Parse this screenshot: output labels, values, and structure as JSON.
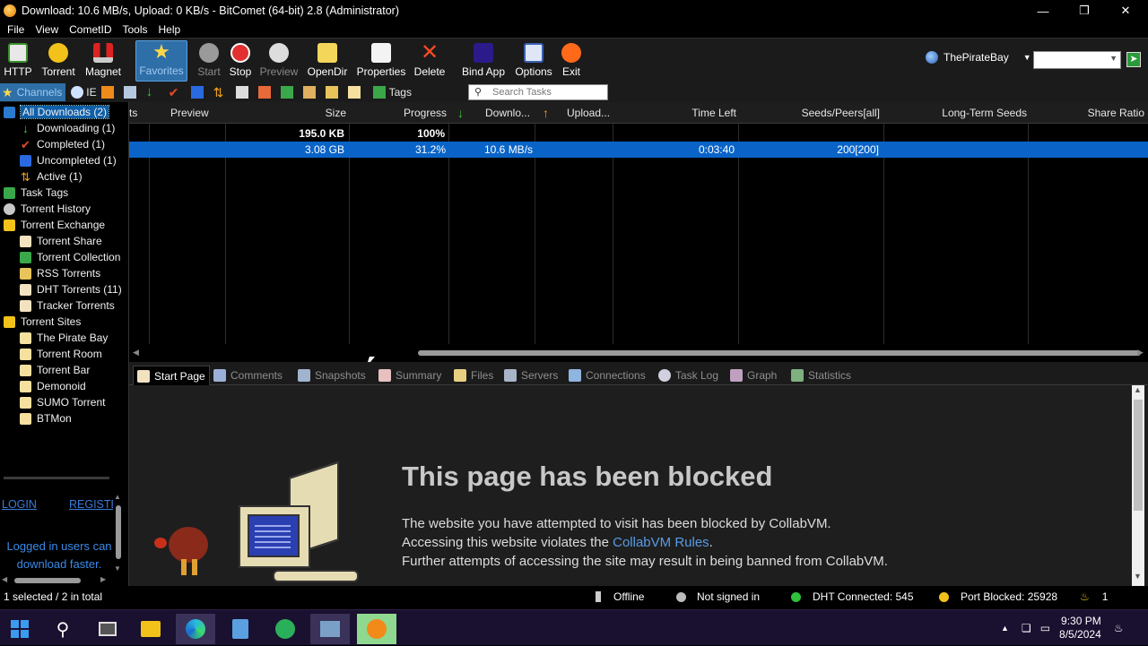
{
  "window": {
    "title": "Download: 10.6 MB/s, Upload: 0 KB/s - BitComet (64-bit) 2.8 (Administrator)"
  },
  "menu": [
    "File",
    "View",
    "CometID",
    "Tools",
    "Help"
  ],
  "toolbar": {
    "buttons": [
      {
        "label": "HTTP",
        "icon": "http-download-icon"
      },
      {
        "label": "Torrent",
        "icon": "torrent-icon"
      },
      {
        "label": "Magnet",
        "icon": "magnet-icon"
      },
      {
        "label": "Favorites",
        "icon": "star-icon"
      },
      {
        "label": "Start",
        "icon": "start-icon"
      },
      {
        "label": "Stop",
        "icon": "stop-icon"
      },
      {
        "label": "Preview",
        "icon": "preview-icon"
      },
      {
        "label": "OpenDir",
        "icon": "folder-icon"
      },
      {
        "label": "Properties",
        "icon": "properties-icon"
      },
      {
        "label": "Delete",
        "icon": "delete-icon"
      },
      {
        "label": "Bind App",
        "icon": "bind-app-icon"
      },
      {
        "label": "Options",
        "icon": "options-icon"
      },
      {
        "label": "Exit",
        "icon": "exit-icon"
      }
    ],
    "site_selector": "ThePirateBay"
  },
  "toolbar2": {
    "channels_label": "Channels",
    "ie_label": "IE",
    "tags_label": "Tags",
    "search_placeholder": "Search Tasks"
  },
  "sidebar": {
    "items": [
      {
        "label": "All Downloads (2)",
        "selected": true
      },
      {
        "label": "Downloading (1)"
      },
      {
        "label": "Completed (1)"
      },
      {
        "label": "Uncompleted (1)"
      },
      {
        "label": "Active (1)"
      },
      {
        "label": "Task Tags"
      },
      {
        "label": "Torrent History"
      },
      {
        "label": "Torrent Exchange"
      },
      {
        "label": "Torrent Share"
      },
      {
        "label": "Torrent Collection"
      },
      {
        "label": "RSS Torrents"
      },
      {
        "label": "DHT Torrents (11)"
      },
      {
        "label": "Tracker Torrents"
      },
      {
        "label": "Torrent Sites"
      },
      {
        "label": "The Pirate Bay"
      },
      {
        "label": "Torrent Room"
      },
      {
        "label": "Torrent Bar"
      },
      {
        "label": "Demonoid"
      },
      {
        "label": "SUMO Torrent"
      },
      {
        "label": "BTMon"
      }
    ],
    "login": "LOGIN",
    "register": "REGISTER",
    "promo": "Logged in users can download faster."
  },
  "columns": [
    "ts",
    "Preview",
    "Size",
    "Progress",
    "Downlo...",
    "Upload...",
    "Time Left",
    "Seeds/Peers[all]",
    "Long-Term Seeds",
    "Share Ratio"
  ],
  "tasks": [
    {
      "size": "195.0 KB",
      "progress": "100%",
      "download": "",
      "time_left": "",
      "seeds": ""
    },
    {
      "size": "3.08 GB",
      "progress": "31.2%",
      "download": "10.6 MB/s",
      "time_left": "0:03:40",
      "seeds": "200[200]"
    }
  ],
  "tabs": [
    "Start Page",
    "Comments",
    "Snapshots",
    "Summary",
    "Files",
    "Servers",
    "Connections",
    "Task Log",
    "Graph",
    "Statistics"
  ],
  "blocked": {
    "heading": "This page has been blocked",
    "line1": "The website you have attempted to visit has been blocked by CollabVM.",
    "line2_prefix": "Accessing this website violates the ",
    "line2_link": "CollabVM Rules",
    "line2_suffix": ".",
    "line3": "Further attempts of accessing the site may result in being banned from CollabVM."
  },
  "status": {
    "selection": "1 selected / 2 in total",
    "offline": "Offline",
    "signin": "Not signed in",
    "dht": "DHT Connected: 545",
    "port": "Port Blocked: 25928",
    "alerts": "1"
  },
  "tray": {
    "time": "9:30 PM",
    "date": "8/5/2024"
  },
  "colors": {
    "selection": "#0a64c8",
    "accent": "#0f5fa8",
    "link": "#5a9be6"
  }
}
